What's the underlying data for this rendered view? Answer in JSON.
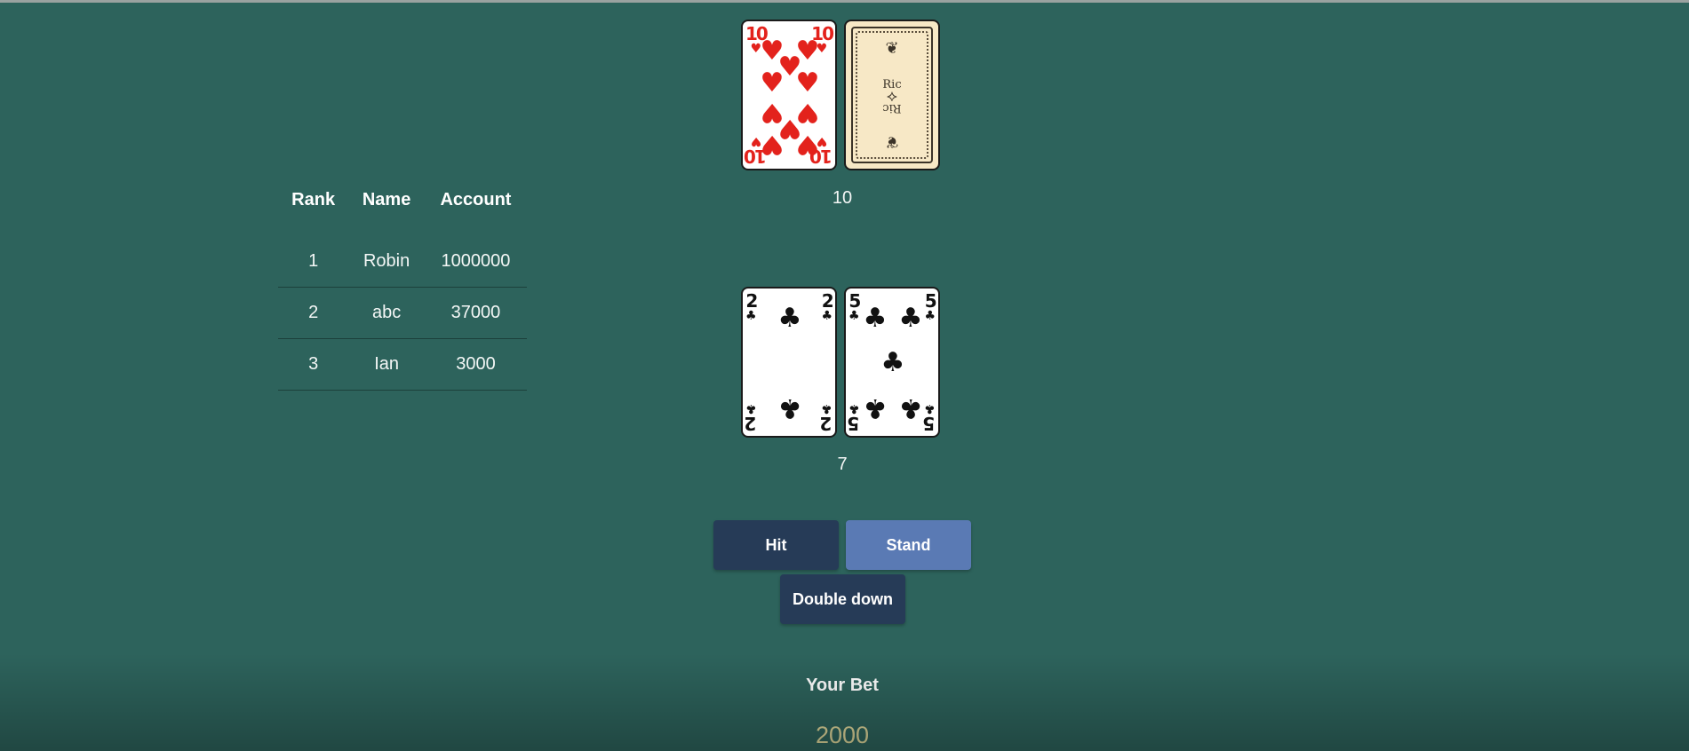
{
  "leaderboard": {
    "headers": {
      "rank": "Rank",
      "name": "Name",
      "account": "Account"
    },
    "rows": [
      {
        "rank": "1",
        "name": "Robin",
        "account": "1000000"
      },
      {
        "rank": "2",
        "name": "abc",
        "account": "37000"
      },
      {
        "rank": "3",
        "name": "Ian",
        "account": "3000"
      }
    ]
  },
  "dealer": {
    "cards": [
      {
        "rank": "10",
        "suit": "hearts",
        "suit_symbol": "♥",
        "color": "#e3221c",
        "face_up": true
      },
      {
        "face_up": false,
        "back_text": "Ric"
      }
    ],
    "total": "10"
  },
  "player": {
    "cards": [
      {
        "rank": "2",
        "suit": "clubs",
        "suit_symbol": "♣",
        "color": "#111111",
        "face_up": true
      },
      {
        "rank": "5",
        "suit": "clubs",
        "suit_symbol": "♣",
        "color": "#111111",
        "face_up": true
      }
    ],
    "total": "7"
  },
  "actions": {
    "hit_label": "Hit",
    "stand_label": "Stand",
    "double_down_label": "Double down"
  },
  "bet": {
    "label": "Your Bet",
    "value": "2000"
  },
  "colors": {
    "table_felt": "#2d635c",
    "button_dark": "#263b57",
    "button_light": "#5a7ab4",
    "bet_value": "#ddd69a",
    "red_suit": "#e3221c"
  }
}
